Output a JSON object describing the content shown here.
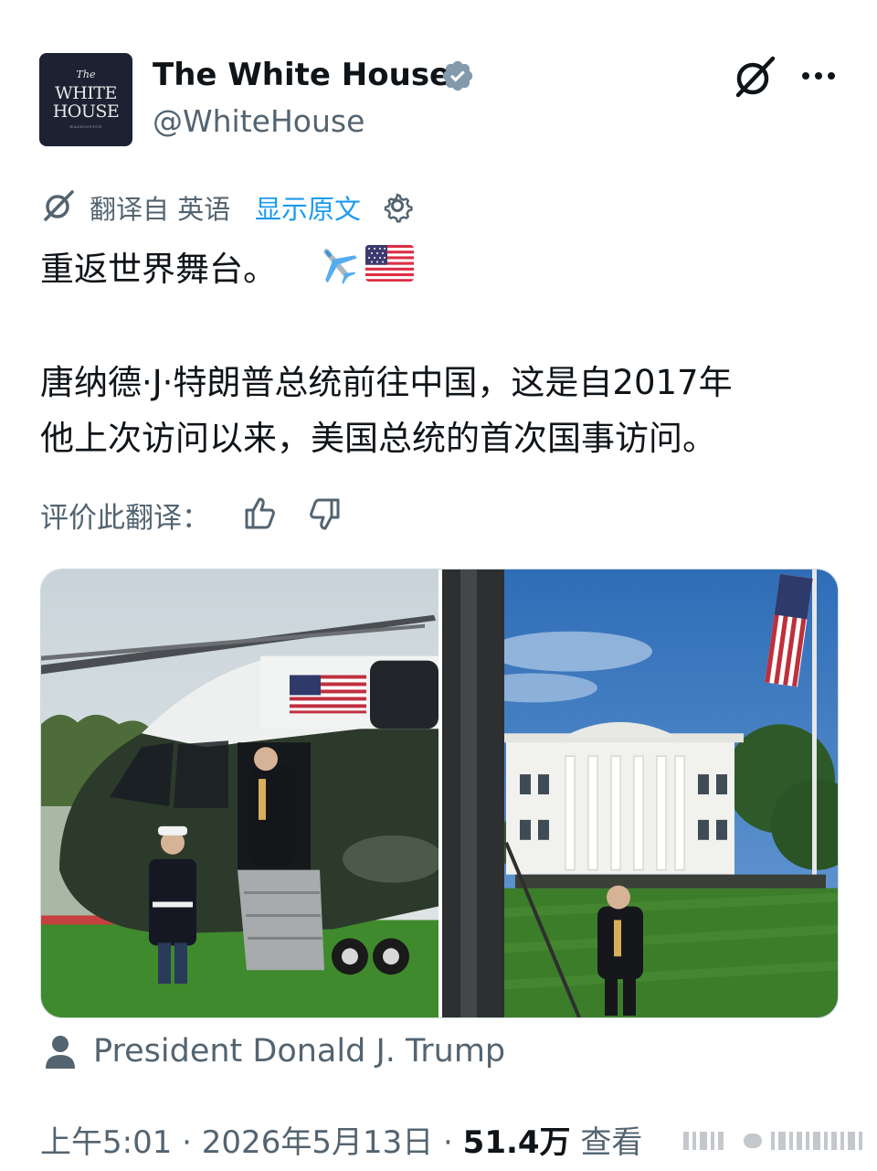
{
  "account": {
    "avatar_line1": "The",
    "avatar_line2": "WHITE",
    "avatar_line3": "HOUSE",
    "avatar_line4": "WASHINGTON",
    "display_name": "The White House",
    "handle": "@WhiteHouse",
    "verified_color": "#829aab"
  },
  "translation": {
    "from_label": "翻译自 英语",
    "show_original": "显示原文",
    "link_color": "#1d9bf0"
  },
  "tweet": {
    "line1": "重返世界舞台。",
    "line2": "唐纳德·J·特朗普总统前往中国，这是自2017年",
    "line3": "他上次访问以来，美国总统的首次国事访问。",
    "emoji": [
      "airplane-emoji",
      "us-flag-emoji"
    ]
  },
  "rating": {
    "label": "评价此翻译："
  },
  "media": {
    "photo1": "helicopter-photo",
    "photo2": "white-house-lawn-photo"
  },
  "tag": {
    "person": "President Donald J. Trump"
  },
  "meta": {
    "time": "上午5:01",
    "sep1": " · ",
    "date": "2026年5月13日",
    "sep2": " · ",
    "views": "51.4万",
    "views_label": " 查看"
  }
}
